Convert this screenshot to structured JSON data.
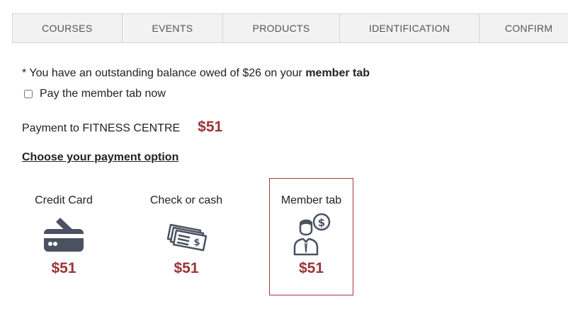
{
  "tabs": [
    "COURSES",
    "EVENTS",
    "PRODUCTS",
    "IDENTIFICATION",
    "CONFIRM"
  ],
  "notice": {
    "prefix": "* You have an outstanding balance owed of $26 on your ",
    "emphasis": "member tab"
  },
  "pay_now": {
    "label": "Pay the member tab now",
    "checked": false
  },
  "payment": {
    "label": "Payment to FITNESS CENTRE",
    "amount": "$51"
  },
  "choose_title": "Choose your payment option",
  "options": [
    {
      "label": "Credit Card",
      "amount": "$51",
      "icon": "credit-card-icon",
      "selected": false
    },
    {
      "label": "Check or cash",
      "amount": "$51",
      "icon": "cash-icon",
      "selected": false
    },
    {
      "label": "Member tab",
      "amount": "$51",
      "icon": "member-dollar-icon",
      "selected": true
    }
  ],
  "colors": {
    "accent": "#9b3438",
    "icon": "#4a5160",
    "tab_bg": "#f2f2f2"
  }
}
